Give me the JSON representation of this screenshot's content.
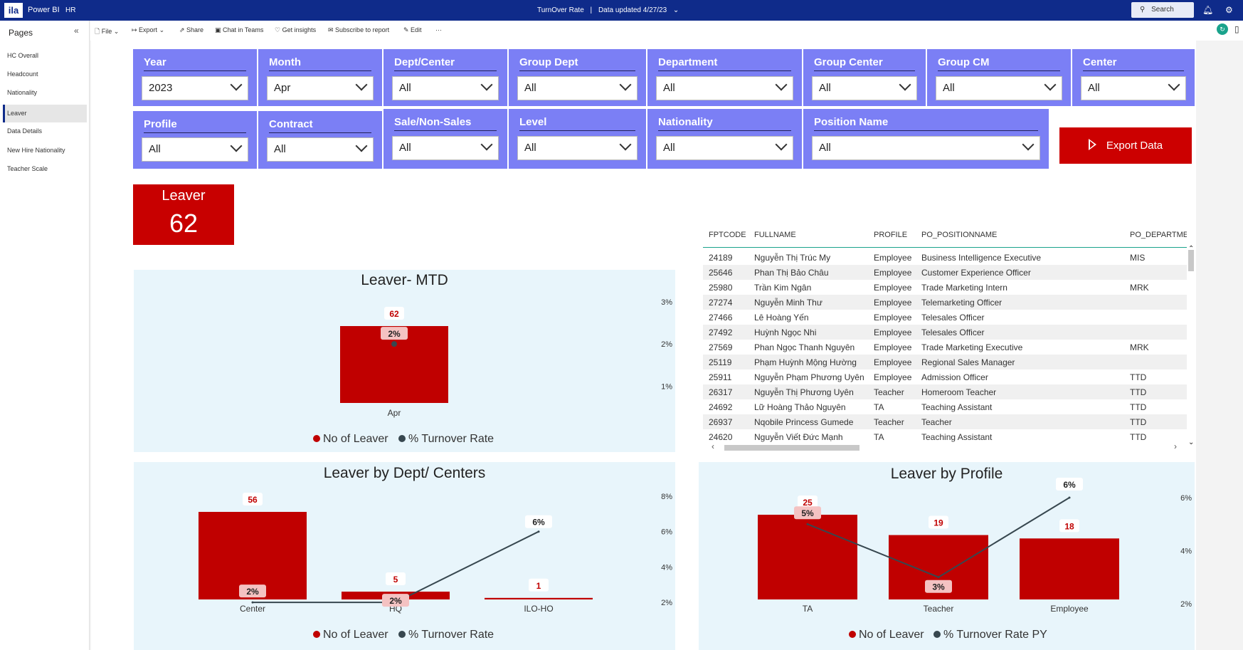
{
  "topbar": {
    "logo": "ila",
    "app_name": "Power BI",
    "workspace": "HR",
    "report_title": "TurnOver Rate",
    "separator": "|",
    "data_updated": "Data updated 4/27/23",
    "search_placeholder": "Search"
  },
  "sidebar": {
    "title": "Pages",
    "items": [
      {
        "label": "HC Overall"
      },
      {
        "label": "Headcount"
      },
      {
        "label": "Nationality"
      },
      {
        "label": "Leaver",
        "active": true
      },
      {
        "label": "Data Details"
      },
      {
        "label": "New Hire Nationality"
      },
      {
        "label": "Teacher Scale"
      }
    ]
  },
  "toolbar": {
    "file": "File",
    "export": "Export",
    "share": "Share",
    "chat": "Chat in Teams",
    "insights": "Get insights",
    "subscribe": "Subscribe to report",
    "edit": "Edit",
    "more": "···"
  },
  "slicers": [
    {
      "label": "Year",
      "value": "2023"
    },
    {
      "label": "Month",
      "value": "Apr"
    },
    {
      "label": "Dept/Center",
      "value": "All"
    },
    {
      "label": "Group Dept",
      "value": "All"
    },
    {
      "label": "Department",
      "value": "All"
    },
    {
      "label": "Group Center",
      "value": "All"
    },
    {
      "label": "Group CM",
      "value": "All"
    },
    {
      "label": "Center",
      "value": "All"
    },
    {
      "label": "Profile",
      "value": "All"
    },
    {
      "label": "Contract",
      "value": "All"
    },
    {
      "label": "Sale/Non-Sales",
      "value": "All"
    },
    {
      "label": "Level",
      "value": "All"
    },
    {
      "label": "Nationality",
      "value": "All"
    },
    {
      "label": "Position Name",
      "value": "All"
    }
  ],
  "export_button": "Export Data",
  "kpi": {
    "title": "Leaver",
    "value": "62"
  },
  "colors": {
    "bar": "#c00000",
    "line": "#37474f",
    "slicer": "#7b7ff5",
    "panel": "#e8f5fb",
    "topbar": "#0f2b8a"
  },
  "chart_data": [
    {
      "type": "bar",
      "title": "Leaver- MTD",
      "categories": [
        "Apr"
      ],
      "series": [
        {
          "name": "No of Leaver",
          "values": [
            62
          ]
        },
        {
          "name": "% Turnover Rate",
          "values": [
            2
          ]
        }
      ],
      "bar_labels": [
        "62"
      ],
      "line_labels": [
        "2%"
      ],
      "y2_ticks": [
        "3%",
        "2%",
        "1%"
      ],
      "y2lim": [
        0.6,
        3.0
      ]
    },
    {
      "type": "bar",
      "title": "Leaver by Dept/ Centers",
      "categories": [
        "Center",
        "HQ",
        "ILO-HO"
      ],
      "series": [
        {
          "name": "No of Leaver",
          "values": [
            56,
            5,
            1
          ]
        },
        {
          "name": "% Turnover Rate",
          "values": [
            2,
            2,
            6
          ]
        }
      ],
      "bar_labels": [
        "56",
        "5",
        "1"
      ],
      "line_labels": [
        "2%",
        "2%",
        "6%"
      ],
      "y2_ticks": [
        "8%",
        "6%",
        "4%",
        "2%"
      ],
      "y2lim": [
        1.2,
        8
      ]
    },
    {
      "type": "bar",
      "title": "Leaver by Profile",
      "categories": [
        "TA",
        "Teacher",
        "Employee"
      ],
      "series": [
        {
          "name": "No of Leaver",
          "values": [
            25,
            19,
            18
          ]
        },
        {
          "name": "% Turnover Rate PY",
          "values": [
            5,
            3,
            6
          ]
        }
      ],
      "bar_labels": [
        "25",
        "19",
        "18"
      ],
      "line_labels": [
        "5%",
        "3%",
        "6%"
      ],
      "y2_ticks": [
        "6%",
        "4%",
        "2%"
      ],
      "y2lim": [
        1.3,
        6
      ]
    }
  ],
  "table": {
    "columns": [
      "FPTCODE",
      "FULLNAME",
      "PROFILE",
      "PO_POSITIONNAME",
      "PO_DEPARTME"
    ],
    "rows": [
      [
        "24189",
        "Nguyễn Thị Trúc My",
        "Employee",
        "Business Intelligence Executive",
        "MIS"
      ],
      [
        "25646",
        "Phan Thị Bảo Châu",
        "Employee",
        "Customer Experience Officer",
        ""
      ],
      [
        "25980",
        "Trần Kim Ngân",
        "Employee",
        "Trade Marketing Intern",
        "MRK"
      ],
      [
        "27274",
        "Nguyễn Minh Thư",
        "Employee",
        "Telemarketing Officer",
        ""
      ],
      [
        "27466",
        "Lê Hoàng Yến",
        "Employee",
        "Telesales Officer",
        ""
      ],
      [
        "27492",
        "Huỳnh Ngọc Nhi",
        "Employee",
        "Telesales Officer",
        ""
      ],
      [
        "27569",
        "Phan Ngọc Thanh Nguyên",
        "Employee",
        "Trade Marketing Executive",
        "MRK"
      ],
      [
        "25119",
        "Phạm Huỳnh Mộng Hường",
        "Employee",
        "Regional Sales Manager",
        ""
      ],
      [
        "25911",
        "Nguyễn Phạm Phương Uyên",
        "Employee",
        "Admission Officer",
        "TTD"
      ],
      [
        "26317",
        "Nguyễn Thị Phương Uyên",
        "Teacher",
        "Homeroom Teacher",
        "TTD"
      ],
      [
        "24692",
        "Lữ Hoàng Thảo Nguyên",
        "TA",
        "Teaching Assistant",
        "TTD"
      ],
      [
        "26937",
        "Nqobile Princess Gumede",
        "Teacher",
        "Teacher",
        "TTD"
      ],
      [
        "24620",
        "Nguyễn Viết Đức Mạnh",
        "TA",
        "Teaching Assistant",
        "TTD"
      ]
    ]
  }
}
